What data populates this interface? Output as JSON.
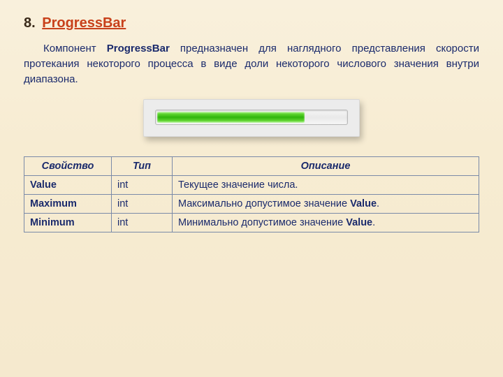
{
  "heading": {
    "number": "8.",
    "title": "ProgressBar"
  },
  "paragraph": {
    "pre": "Компонент ",
    "bold": "ProgressBar",
    "post": " предназначен для наглядного представления скорости протекания некоторого процесса в виде доли некоторого числового значения внутри диапазона."
  },
  "progress": {
    "percent": 78
  },
  "table": {
    "headers": {
      "property": "Свойство",
      "type": "Тип",
      "description": "Описание"
    },
    "rows": [
      {
        "name": "Value",
        "type": "int",
        "desc_pre": "Текущее значение числа.",
        "desc_bold": ""
      },
      {
        "name": "Maximum",
        "type": "int",
        "desc_pre": "Максимально допустимое значение ",
        "desc_bold": "Value",
        "desc_post": "."
      },
      {
        "name": "Minimum",
        "type": "int",
        "desc_pre": "Минимально допустимое значение ",
        "desc_bold": "Value",
        "desc_post": "."
      }
    ]
  }
}
